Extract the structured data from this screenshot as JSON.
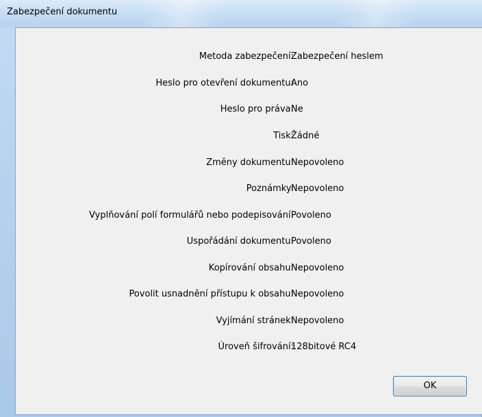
{
  "dialog": {
    "title": "Zabezpečení dokumentu",
    "ok_label": "OK"
  },
  "properties": [
    {
      "label": "Metoda zabezpečení:",
      "value": "Zabezpečení heslem"
    },
    {
      "label": "Heslo pro otevření dokumentu:",
      "value": "Ano"
    },
    {
      "label": "Heslo pro práva:",
      "value": "Ne"
    },
    {
      "label": "Tisk:",
      "value": "Žádné"
    },
    {
      "label": "Změny dokumentu:",
      "value": "Nepovoleno"
    },
    {
      "label": "Poznámky:",
      "value": "Nepovoleno"
    },
    {
      "label": "Vyplňování polí formulářů nebo podepisování:",
      "value": "Povoleno"
    },
    {
      "label": "Uspořádání dokumentu:",
      "value": "Povoleno"
    },
    {
      "label": "Kopírování obsahu:",
      "value": "Nepovoleno"
    },
    {
      "label": "Povolit usnadnění přístupu k obsahu:",
      "value": "Nepovoleno"
    },
    {
      "label": "Vyjímání stránek:",
      "value": "Nepovoleno"
    },
    {
      "label": "Úroveň šifrování:",
      "value": "128bitové RC4"
    }
  ]
}
